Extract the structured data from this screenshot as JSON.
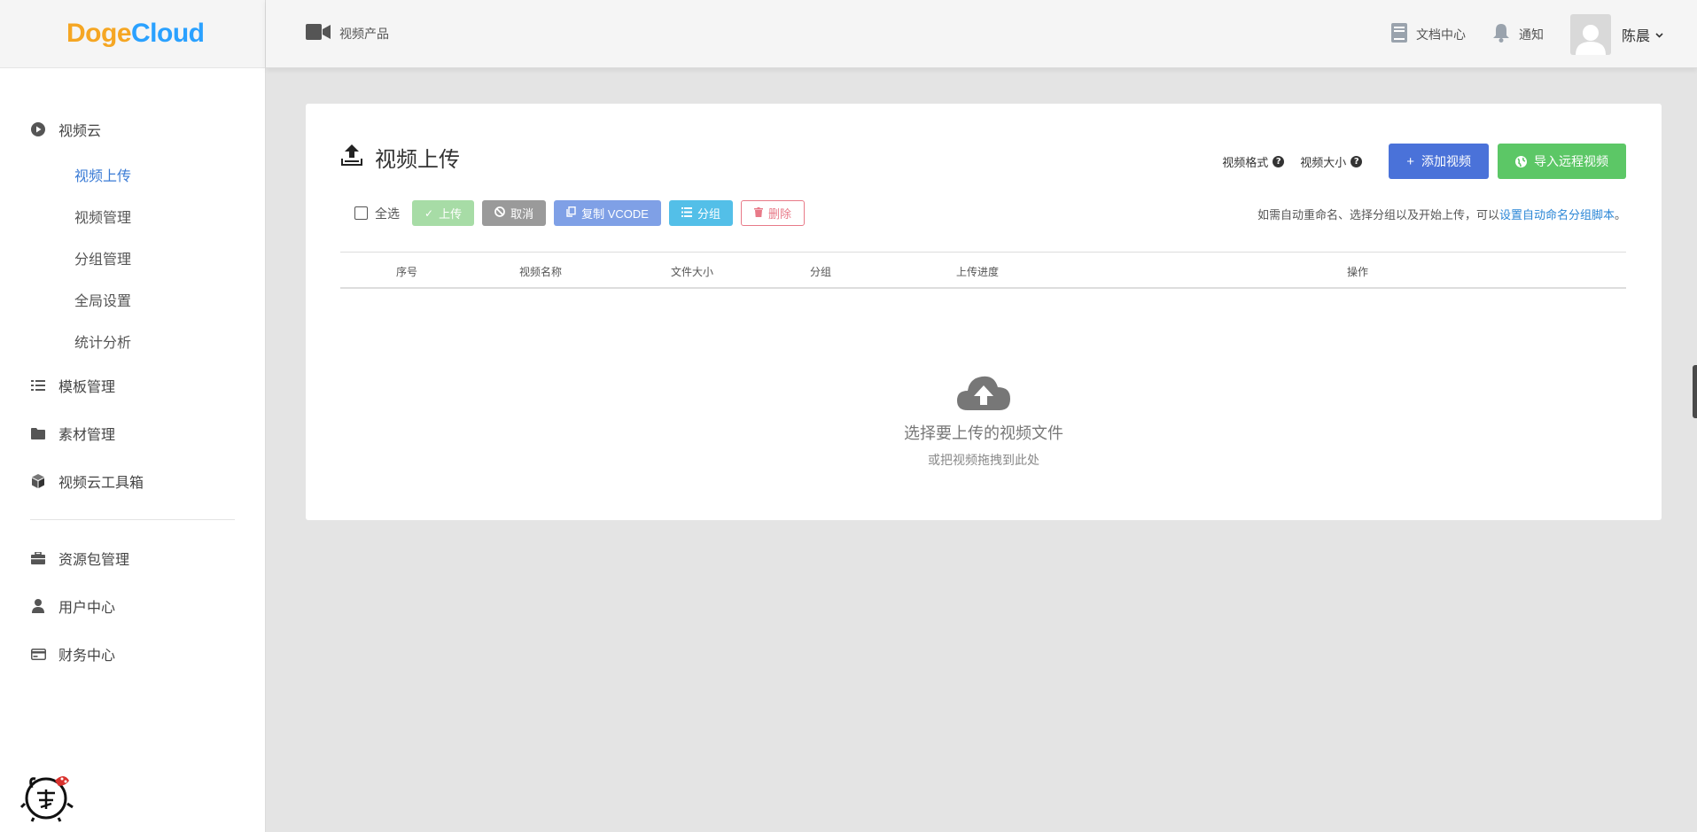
{
  "brand": {
    "part1": "Doge",
    "part2": "Cloud"
  },
  "sidebar": {
    "items": [
      {
        "label": "视频云",
        "icon": "play-circle-icon"
      },
      {
        "label": "模板管理",
        "icon": "list-icon"
      },
      {
        "label": "素材管理",
        "icon": "folder-icon"
      },
      {
        "label": "视频云工具箱",
        "icon": "cube-icon"
      },
      {
        "label": "资源包管理",
        "icon": "briefcase-icon"
      },
      {
        "label": "用户中心",
        "icon": "user-icon"
      },
      {
        "label": "财务中心",
        "icon": "credit-card-icon"
      }
    ],
    "subitems": [
      {
        "label": "视频上传",
        "active": true
      },
      {
        "label": "视频管理"
      },
      {
        "label": "分组管理"
      },
      {
        "label": "全局设置"
      },
      {
        "label": "统计分析"
      }
    ],
    "active_color": "#3a7bd5"
  },
  "topbar": {
    "product_label": "视频产品",
    "docs_label": "文档中心",
    "notify_label": "通知",
    "username": "陈晨"
  },
  "page": {
    "title": "视频上传",
    "format_help": "视频格式",
    "size_help": "视频大小",
    "add_video": "添加视频",
    "import_remote": "导入远程视频"
  },
  "toolbar": {
    "select_all": "全选",
    "upload": "上传",
    "cancel": "取消",
    "copy_vcode": "复制 VCODE",
    "group": "分组",
    "delete": "删除",
    "hint_prefix": "如需自动重命名、选择分组以及开始上传，可以",
    "hint_link": "设置自动命名分组脚本",
    "hint_suffix": "。"
  },
  "table": {
    "columns": [
      "序号",
      "视频名称",
      "文件大小",
      "分组",
      "上传进度",
      "操作"
    ]
  },
  "empty": {
    "title": "选择要上传的视频文件",
    "subtitle": "或把视频拖拽到此处"
  },
  "colors": {
    "primary": "#4a72d9",
    "green": "#5cc766",
    "brand_orange": "#f5a623",
    "brand_blue": "#2aa1ff"
  }
}
